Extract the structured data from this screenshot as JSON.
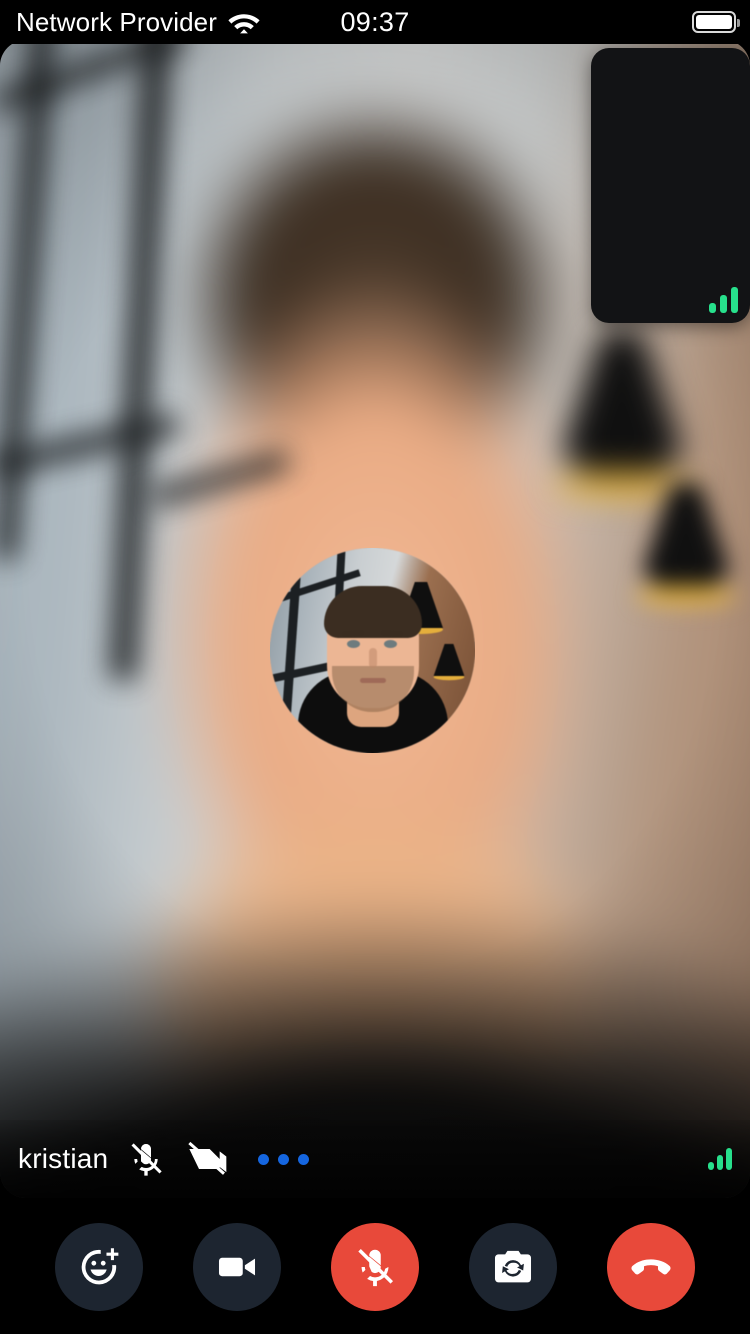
{
  "status_bar": {
    "carrier": "Network Provider",
    "wifi_icon": "wifi-icon",
    "time": "09:37",
    "battery_icon": "battery-full-icon"
  },
  "call": {
    "remote": {
      "participant_name": "kristian",
      "mic_state_icon": "mic-off-icon",
      "camera_state_icon": "video-off-icon",
      "more_options_icon": "more-horizontal-icon",
      "connection_icon": "signal-bars-icon",
      "avatar_icon": "participant-avatar"
    },
    "self_view": {
      "camera_state": "off",
      "connection_icon": "signal-bars-icon"
    }
  },
  "controls": [
    {
      "name": "reaction-button",
      "icon": "smiley-plus-icon",
      "style": "neutral"
    },
    {
      "name": "video-toggle-button",
      "icon": "video-camera-icon",
      "style": "neutral"
    },
    {
      "name": "mic-toggle-button",
      "icon": "mic-off-icon",
      "style": "danger"
    },
    {
      "name": "switch-camera-button",
      "icon": "camera-flip-icon",
      "style": "neutral"
    },
    {
      "name": "end-call-button",
      "icon": "phone-hangup-icon",
      "style": "danger"
    }
  ],
  "colors": {
    "danger": "#e8493a",
    "neutral_button": "#1d2530",
    "accent_blue": "#1566e0",
    "signal_green": "#27e08c",
    "background": "#000000"
  }
}
